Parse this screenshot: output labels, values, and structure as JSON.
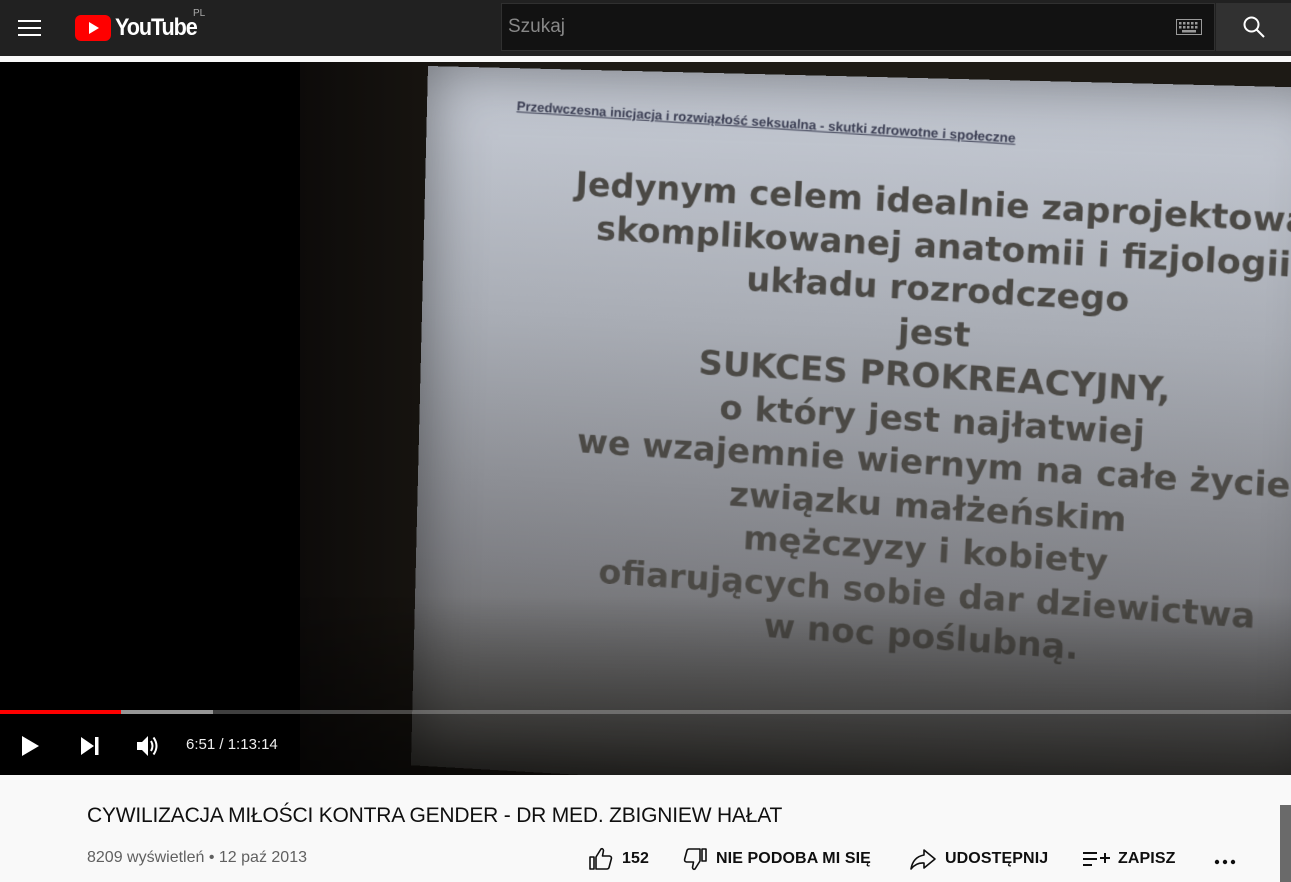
{
  "masthead": {
    "logo_text": "YouTube",
    "country_code": "PL",
    "search_placeholder": "Szukaj"
  },
  "slide": {
    "header": "Przedwczesna inicjacja i rozwiązłość seksualna - skutki zdrowotne i społeczne",
    "lines": [
      "Jedynym celem idealnie zaprojektowanej",
      "skomplikowanej anatomii i fizjologii",
      "układu rozrodczego",
      "jest",
      "SUKCES PROKREACYJNY,",
      "o który jest najłatwiej",
      "we wzajemnie wiernym na całe życie",
      "związku małżeńskim",
      "mężczyzy i kobiety",
      "ofiarujących sobie dar dziewictwa",
      "w noc poślubną."
    ]
  },
  "player": {
    "current_time": "6:51",
    "duration": "1:13:14",
    "time_separator": " / ",
    "progress_fraction": 0.0936,
    "buffer_fraction": 0.165
  },
  "video": {
    "title": "CYWILIZACJA MIŁOŚCI KONTRA GENDER - DR MED. ZBIGNIEW HAŁAT",
    "views": "8209 wyświetleń",
    "separator": " • ",
    "date": "12 paź 2013"
  },
  "actions": {
    "like_count": "152",
    "dislike_label": "NIE PODOBA MI SIĘ",
    "share_label": "UDOSTĘPNIJ",
    "save_label": "ZAPISZ"
  },
  "colors": {
    "masthead_bg": "#212121",
    "brand_red": "#ff0000",
    "progress_red": "#ff0000",
    "page_bg": "#f9f9f9"
  }
}
